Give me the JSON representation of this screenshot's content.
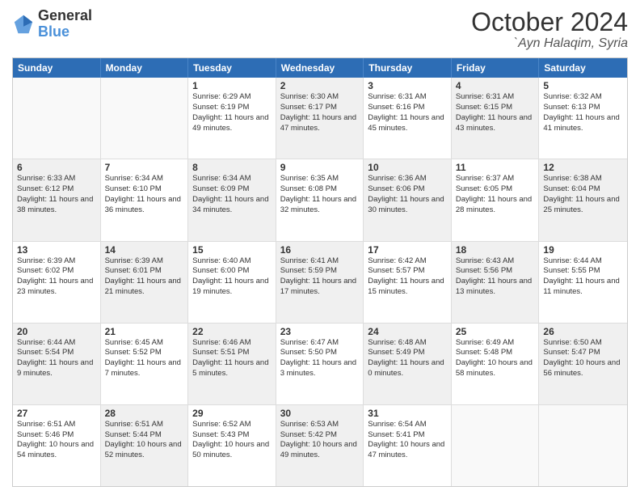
{
  "header": {
    "logo_line1": "General",
    "logo_line2": "Blue",
    "month": "October 2024",
    "location": "`Ayn Halaqim, Syria"
  },
  "days_of_week": [
    "Sunday",
    "Monday",
    "Tuesday",
    "Wednesday",
    "Thursday",
    "Friday",
    "Saturday"
  ],
  "weeks": [
    [
      {
        "day": "",
        "sunrise": "",
        "sunset": "",
        "daylight": "",
        "shaded": true,
        "empty": true
      },
      {
        "day": "",
        "sunrise": "",
        "sunset": "",
        "daylight": "",
        "shaded": true,
        "empty": true
      },
      {
        "day": "1",
        "sunrise": "Sunrise: 6:29 AM",
        "sunset": "Sunset: 6:19 PM",
        "daylight": "Daylight: 11 hours and 49 minutes.",
        "shaded": false
      },
      {
        "day": "2",
        "sunrise": "Sunrise: 6:30 AM",
        "sunset": "Sunset: 6:17 PM",
        "daylight": "Daylight: 11 hours and 47 minutes.",
        "shaded": true
      },
      {
        "day": "3",
        "sunrise": "Sunrise: 6:31 AM",
        "sunset": "Sunset: 6:16 PM",
        "daylight": "Daylight: 11 hours and 45 minutes.",
        "shaded": false
      },
      {
        "day": "4",
        "sunrise": "Sunrise: 6:31 AM",
        "sunset": "Sunset: 6:15 PM",
        "daylight": "Daylight: 11 hours and 43 minutes.",
        "shaded": true
      },
      {
        "day": "5",
        "sunrise": "Sunrise: 6:32 AM",
        "sunset": "Sunset: 6:13 PM",
        "daylight": "Daylight: 11 hours and 41 minutes.",
        "shaded": false
      }
    ],
    [
      {
        "day": "6",
        "sunrise": "Sunrise: 6:33 AM",
        "sunset": "Sunset: 6:12 PM",
        "daylight": "Daylight: 11 hours and 38 minutes.",
        "shaded": true
      },
      {
        "day": "7",
        "sunrise": "Sunrise: 6:34 AM",
        "sunset": "Sunset: 6:10 PM",
        "daylight": "Daylight: 11 hours and 36 minutes.",
        "shaded": false
      },
      {
        "day": "8",
        "sunrise": "Sunrise: 6:34 AM",
        "sunset": "Sunset: 6:09 PM",
        "daylight": "Daylight: 11 hours and 34 minutes.",
        "shaded": true
      },
      {
        "day": "9",
        "sunrise": "Sunrise: 6:35 AM",
        "sunset": "Sunset: 6:08 PM",
        "daylight": "Daylight: 11 hours and 32 minutes.",
        "shaded": false
      },
      {
        "day": "10",
        "sunrise": "Sunrise: 6:36 AM",
        "sunset": "Sunset: 6:06 PM",
        "daylight": "Daylight: 11 hours and 30 minutes.",
        "shaded": true
      },
      {
        "day": "11",
        "sunrise": "Sunrise: 6:37 AM",
        "sunset": "Sunset: 6:05 PM",
        "daylight": "Daylight: 11 hours and 28 minutes.",
        "shaded": false
      },
      {
        "day": "12",
        "sunrise": "Sunrise: 6:38 AM",
        "sunset": "Sunset: 6:04 PM",
        "daylight": "Daylight: 11 hours and 25 minutes.",
        "shaded": true
      }
    ],
    [
      {
        "day": "13",
        "sunrise": "Sunrise: 6:39 AM",
        "sunset": "Sunset: 6:02 PM",
        "daylight": "Daylight: 11 hours and 23 minutes.",
        "shaded": false
      },
      {
        "day": "14",
        "sunrise": "Sunrise: 6:39 AM",
        "sunset": "Sunset: 6:01 PM",
        "daylight": "Daylight: 11 hours and 21 minutes.",
        "shaded": true
      },
      {
        "day": "15",
        "sunrise": "Sunrise: 6:40 AM",
        "sunset": "Sunset: 6:00 PM",
        "daylight": "Daylight: 11 hours and 19 minutes.",
        "shaded": false
      },
      {
        "day": "16",
        "sunrise": "Sunrise: 6:41 AM",
        "sunset": "Sunset: 5:59 PM",
        "daylight": "Daylight: 11 hours and 17 minutes.",
        "shaded": true
      },
      {
        "day": "17",
        "sunrise": "Sunrise: 6:42 AM",
        "sunset": "Sunset: 5:57 PM",
        "daylight": "Daylight: 11 hours and 15 minutes.",
        "shaded": false
      },
      {
        "day": "18",
        "sunrise": "Sunrise: 6:43 AM",
        "sunset": "Sunset: 5:56 PM",
        "daylight": "Daylight: 11 hours and 13 minutes.",
        "shaded": true
      },
      {
        "day": "19",
        "sunrise": "Sunrise: 6:44 AM",
        "sunset": "Sunset: 5:55 PM",
        "daylight": "Daylight: 11 hours and 11 minutes.",
        "shaded": false
      }
    ],
    [
      {
        "day": "20",
        "sunrise": "Sunrise: 6:44 AM",
        "sunset": "Sunset: 5:54 PM",
        "daylight": "Daylight: 11 hours and 9 minutes.",
        "shaded": true
      },
      {
        "day": "21",
        "sunrise": "Sunrise: 6:45 AM",
        "sunset": "Sunset: 5:52 PM",
        "daylight": "Daylight: 11 hours and 7 minutes.",
        "shaded": false
      },
      {
        "day": "22",
        "sunrise": "Sunrise: 6:46 AM",
        "sunset": "Sunset: 5:51 PM",
        "daylight": "Daylight: 11 hours and 5 minutes.",
        "shaded": true
      },
      {
        "day": "23",
        "sunrise": "Sunrise: 6:47 AM",
        "sunset": "Sunset: 5:50 PM",
        "daylight": "Daylight: 11 hours and 3 minutes.",
        "shaded": false
      },
      {
        "day": "24",
        "sunrise": "Sunrise: 6:48 AM",
        "sunset": "Sunset: 5:49 PM",
        "daylight": "Daylight: 11 hours and 0 minutes.",
        "shaded": true
      },
      {
        "day": "25",
        "sunrise": "Sunrise: 6:49 AM",
        "sunset": "Sunset: 5:48 PM",
        "daylight": "Daylight: 10 hours and 58 minutes.",
        "shaded": false
      },
      {
        "day": "26",
        "sunrise": "Sunrise: 6:50 AM",
        "sunset": "Sunset: 5:47 PM",
        "daylight": "Daylight: 10 hours and 56 minutes.",
        "shaded": true
      }
    ],
    [
      {
        "day": "27",
        "sunrise": "Sunrise: 6:51 AM",
        "sunset": "Sunset: 5:46 PM",
        "daylight": "Daylight: 10 hours and 54 minutes.",
        "shaded": false
      },
      {
        "day": "28",
        "sunrise": "Sunrise: 6:51 AM",
        "sunset": "Sunset: 5:44 PM",
        "daylight": "Daylight: 10 hours and 52 minutes.",
        "shaded": true
      },
      {
        "day": "29",
        "sunrise": "Sunrise: 6:52 AM",
        "sunset": "Sunset: 5:43 PM",
        "daylight": "Daylight: 10 hours and 50 minutes.",
        "shaded": false
      },
      {
        "day": "30",
        "sunrise": "Sunrise: 6:53 AM",
        "sunset": "Sunset: 5:42 PM",
        "daylight": "Daylight: 10 hours and 49 minutes.",
        "shaded": true
      },
      {
        "day": "31",
        "sunrise": "Sunrise: 6:54 AM",
        "sunset": "Sunset: 5:41 PM",
        "daylight": "Daylight: 10 hours and 47 minutes.",
        "shaded": false
      },
      {
        "day": "",
        "sunrise": "",
        "sunset": "",
        "daylight": "",
        "shaded": true,
        "empty": true
      },
      {
        "day": "",
        "sunrise": "",
        "sunset": "",
        "daylight": "",
        "shaded": true,
        "empty": true
      }
    ]
  ]
}
